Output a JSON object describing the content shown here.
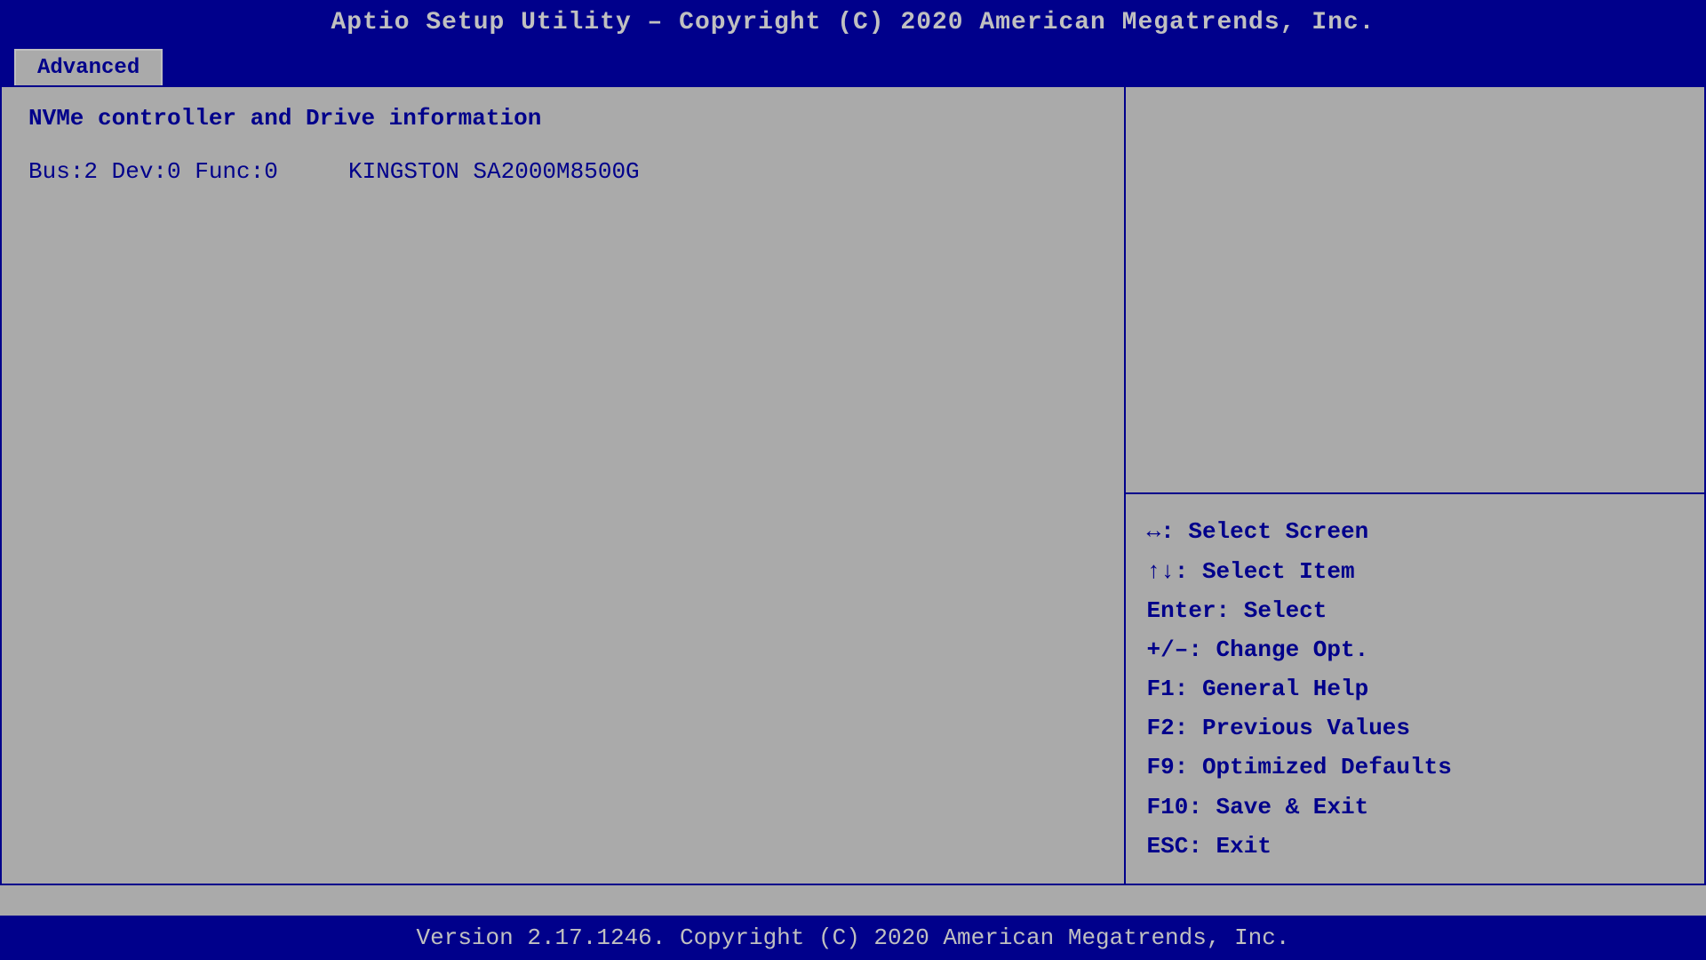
{
  "header": {
    "title": "Aptio Setup Utility – Copyright (C) 2020 American Megatrends, Inc."
  },
  "tabs": {
    "active": "Advanced"
  },
  "left_panel": {
    "section_title": "NVMe controller and Drive information",
    "info_rows": [
      {
        "key": "Bus:2  Dev:0  Func:0",
        "value": "KINGSTON SA2000M8500G"
      }
    ]
  },
  "right_panel": {
    "help_lines": [
      "↔: Select Screen",
      "↑↓: Select Item",
      "Enter: Select",
      "+/–: Change Opt.",
      "F1: General Help",
      "F2: Previous Values",
      "F9: Optimized Defaults",
      "F10: Save & Exit",
      "ESC: Exit"
    ]
  },
  "footer": {
    "text": "Version 2.17.1246. Copyright (C) 2020 American Megatrends, Inc."
  }
}
